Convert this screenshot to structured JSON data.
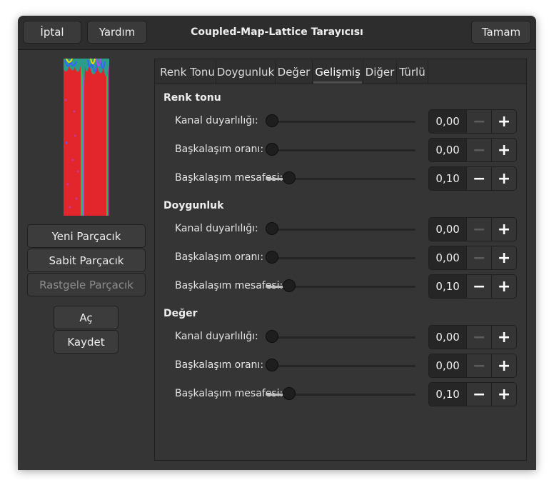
{
  "header": {
    "cancel_label": "İptal",
    "help_label": "Yardım",
    "title": "Coupled-Map-Lattice Tarayıcısı",
    "ok_label": "Tamam"
  },
  "left_panel": {
    "buttons": {
      "new": "Yeni Parçacık",
      "fixed": "Sabit Parçacık",
      "random": "Rastgele Parçacık",
      "open": "Aç",
      "save": "Kaydet"
    }
  },
  "tabs": [
    "Renk Tonu",
    "Doygunluk",
    "Değer",
    "Gelişmiş",
    "Diğer",
    "Türlü"
  ],
  "active_tab": "Gelişmiş",
  "sections": [
    {
      "title": "Renk tonu",
      "rows": [
        {
          "label": "Kanal duyarlılığı:",
          "value": "0,00",
          "level": 0.0,
          "minus_enabled": false
        },
        {
          "label": "Başkalaşım oranı:",
          "value": "0,00",
          "level": 0.0,
          "minus_enabled": false
        },
        {
          "label": "Başkalaşım mesafesi:",
          "value": "0,10",
          "level": 0.1,
          "minus_enabled": true
        }
      ]
    },
    {
      "title": "Doygunluk",
      "rows": [
        {
          "label": "Kanal duyarlılığı:",
          "value": "0,00",
          "level": 0.0,
          "minus_enabled": false
        },
        {
          "label": "Başkalaşım oranı:",
          "value": "0,00",
          "level": 0.0,
          "minus_enabled": false
        },
        {
          "label": "Başkalaşım mesafesi:",
          "value": "0,10",
          "level": 0.1,
          "minus_enabled": true
        }
      ]
    },
    {
      "title": "Değer",
      "rows": [
        {
          "label": "Kanal duyarlılığı:",
          "value": "0,00",
          "level": 0.0,
          "minus_enabled": false
        },
        {
          "label": "Başkalaşım oranı:",
          "value": "0,00",
          "level": 0.0,
          "minus_enabled": false
        },
        {
          "label": "Başkalaşım mesafesi:",
          "value": "0,10",
          "level": 0.1,
          "minus_enabled": true
        }
      ]
    }
  ],
  "spin_icons": {
    "minus": "minus-icon",
    "plus": "plus-icon"
  },
  "colors": {
    "window_bg": "#353535",
    "header_bg": "#2d2d2d",
    "preview_red": "#e3262b",
    "preview_green": "#22c25a"
  }
}
